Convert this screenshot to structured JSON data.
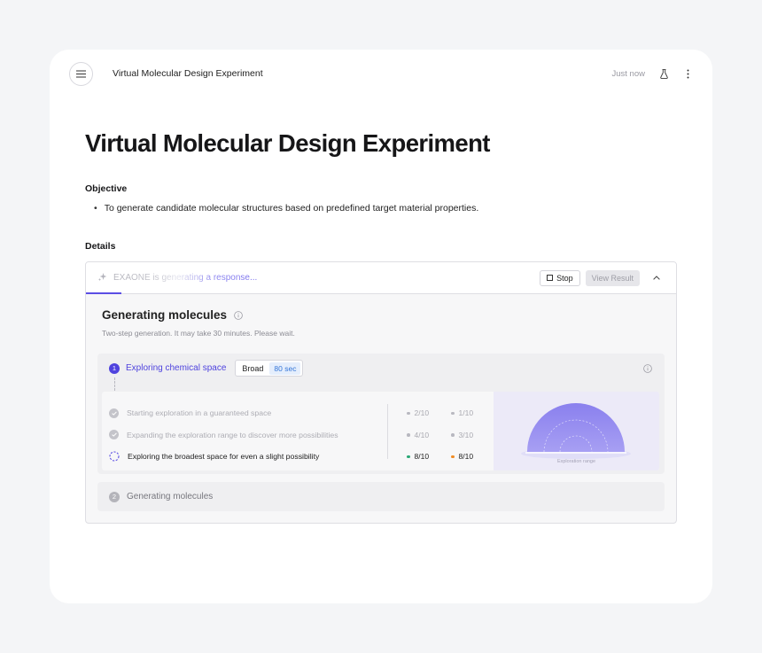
{
  "topbar": {
    "title": "Virtual Molecular Design Experiment",
    "timestamp": "Just now",
    "icons": [
      "menu-icon",
      "flask-icon",
      "more-vertical-icon"
    ]
  },
  "document": {
    "title": "Virtual Molecular Design Experiment",
    "objective_label": "Objective",
    "objective_items": [
      "To generate candidate molecular structures based on predefined target material properties."
    ],
    "details_label": "Details"
  },
  "status_panel": {
    "status_text": "EXAONE is generating a response...",
    "stop_label": "Stop",
    "view_result_label": "View Result",
    "progress_fraction": 0.06
  },
  "generation": {
    "title": "Generating molecules",
    "subtitle": "Two-step generation. It may take 30 minutes. Please wait.",
    "step1": {
      "number": "1",
      "title": "Exploring chemical space",
      "mode": "Broad",
      "duration": "80 sec",
      "tasks": [
        {
          "label": "Starting exploration in a guaranteed space",
          "state": "done",
          "metric_a": "2/10",
          "metric_b": "1/10"
        },
        {
          "label": "Expanding the exploration range to discover more possibilities",
          "state": "done",
          "metric_a": "4/10",
          "metric_b": "3/10"
        },
        {
          "label": "Exploring the broadest space for even a slight possibility",
          "state": "active",
          "metric_a": "8/10",
          "metric_b": "8/10"
        }
      ],
      "viz_label": "Exploration range"
    },
    "step2": {
      "number": "2",
      "title": "Generating molecules"
    }
  },
  "colors": {
    "accent": "#4f43de",
    "badge_blue": "#3576d8",
    "metric_green": "#2aa876",
    "metric_orange": "#f08b24",
    "viz_purple": "#8a80ee"
  }
}
